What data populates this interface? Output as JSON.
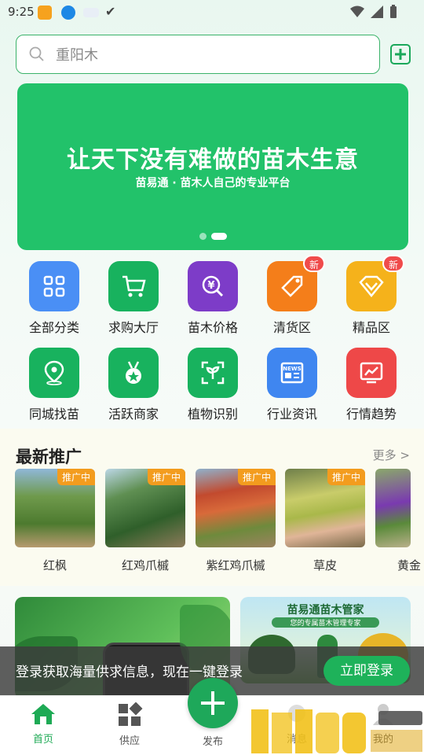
{
  "status_bar": {
    "time": "9:25"
  },
  "search": {
    "placeholder": "重阳木"
  },
  "banner": {
    "title": "让天下没有难做的苗木生意",
    "subtitle": "苗易通 · 苗木人自己的专业平台",
    "slide_count": 2,
    "active_slide": 2
  },
  "grid": {
    "items": [
      {
        "label": "全部分类",
        "icon": "grid-icon",
        "color": "#4a8ff5"
      },
      {
        "label": "求购大厅",
        "icon": "cart-icon",
        "color": "#18b25e"
      },
      {
        "label": "苗木价格",
        "icon": "price-search-icon",
        "color": "#7d3cc8"
      },
      {
        "label": "清货区",
        "icon": "tag-icon",
        "color": "#f47e1a",
        "badge": "新"
      },
      {
        "label": "精品区",
        "icon": "diamond-icon",
        "color": "#f5b21b",
        "badge": "新"
      },
      {
        "label": "同城找苗",
        "icon": "location-icon",
        "color": "#18b25e"
      },
      {
        "label": "活跃商家",
        "icon": "medal-icon",
        "color": "#18b25e"
      },
      {
        "label": "植物识别",
        "icon": "plant-scan-icon",
        "color": "#18b25e"
      },
      {
        "label": "行业资讯",
        "icon": "news-icon",
        "color": "#3f86f0"
      },
      {
        "label": "行情趋势",
        "icon": "trend-chart-icon",
        "color": "#ee4848"
      }
    ]
  },
  "promo": {
    "title": "最新推广",
    "more": "更多 >",
    "tag": "推广中",
    "items": [
      {
        "name": "红枫"
      },
      {
        "name": "红鸡爪槭"
      },
      {
        "name": "紫红鸡爪槭"
      },
      {
        "name": "草皮"
      },
      {
        "name": "黄金"
      }
    ]
  },
  "lower_banners": {
    "right_title": "苗易通苗木管家",
    "right_subtitle": "您的专属苗木管理专家"
  },
  "login_bar": {
    "text": "登录获取海量供求信息，现在一键登录",
    "button": "立即登录"
  },
  "nav": {
    "home": "首页",
    "supply": "供应",
    "publish": "发布",
    "messages": "消息",
    "mine": "我的"
  },
  "colors": {
    "brand_green": "#1eaa55",
    "badge_red": "#f04b4b",
    "promo_tag": "#f39c1e"
  }
}
